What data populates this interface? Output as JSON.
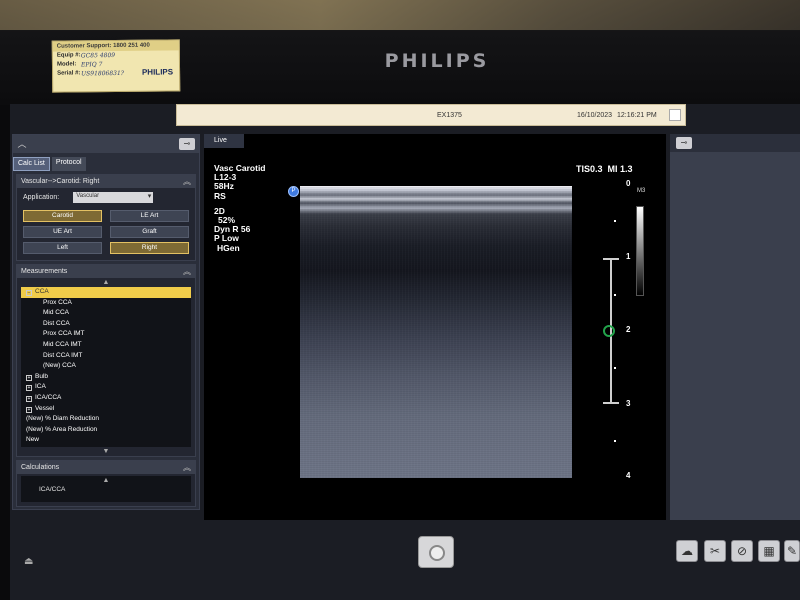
{
  "bezel": {
    "brand": "PHILIPS",
    "sticker": {
      "support": "Customer Support: 1800 251 400",
      "equip_label": "Equip #:",
      "equip_value": "GC85 4809",
      "model_label": "Model:",
      "model_value": "EPIQ 7",
      "serial_label": "Serial #:",
      "serial_value": "US91806831?",
      "logo": "PHILIPS"
    }
  },
  "titlebar": {
    "name": "EX1375",
    "date": "16/10/2023",
    "time": "12:16:21 PM"
  },
  "left_panel": {
    "tabs": [
      "Calc List",
      "Protocol"
    ],
    "protocol_path": "Vascular-->Carotid: Right",
    "application_label": "Application:",
    "application_value": "Vascular",
    "buttons": [
      "Carotid",
      "LE Art",
      "UE Art",
      "Graft",
      "Left",
      "Right"
    ],
    "measurements_header": "Measurements",
    "measurements": [
      {
        "label": "CCA",
        "level": 0,
        "expander": "−",
        "selected": true
      },
      {
        "label": "Prox CCA",
        "level": 1
      },
      {
        "label": "Mid CCA",
        "level": 1
      },
      {
        "label": "Dist CCA",
        "level": 1
      },
      {
        "label": "Prox CCA IMT",
        "level": 1
      },
      {
        "label": "Mid CCA IMT",
        "level": 1
      },
      {
        "label": "Dist CCA IMT",
        "level": 1
      },
      {
        "label": "(New) CCA",
        "level": 1
      },
      {
        "label": "Bulb",
        "level": 0,
        "expander": "+"
      },
      {
        "label": "ICA",
        "level": 0,
        "expander": "+"
      },
      {
        "label": "ICA/CCA",
        "level": 0,
        "expander": "+"
      },
      {
        "label": "Vessel",
        "level": 0,
        "expander": "+"
      },
      {
        "label": "(New) % Diam Reduction",
        "level": 0
      },
      {
        "label": "(New) % Area Reduction",
        "level": 0
      },
      {
        "label": "New",
        "level": 0
      }
    ],
    "calculations_header": "Calculations",
    "calculations": [
      "ICA/CCA"
    ]
  },
  "image_panel": {
    "tab": "Live",
    "preset": "Vasc Carotid",
    "transducer": "L12-3",
    "frame_rate": "58Hz",
    "side": "RS",
    "mode": "2D",
    "gain": "52%",
    "dyn_range": "Dyn R 56",
    "power": "P Low",
    "gen": "HGen",
    "tis": "TIS0.3",
    "mi": "MI 1.3",
    "grayscale_label": "M3",
    "focus_marker": "P",
    "depth_ticks": [
      "0",
      "1",
      "2",
      "3",
      "4"
    ]
  },
  "toolbar": {
    "icons": [
      "cloud-icon",
      "tool-cross-icon",
      "no-entry-icon",
      "grid-icon",
      "edit-icon"
    ]
  }
}
